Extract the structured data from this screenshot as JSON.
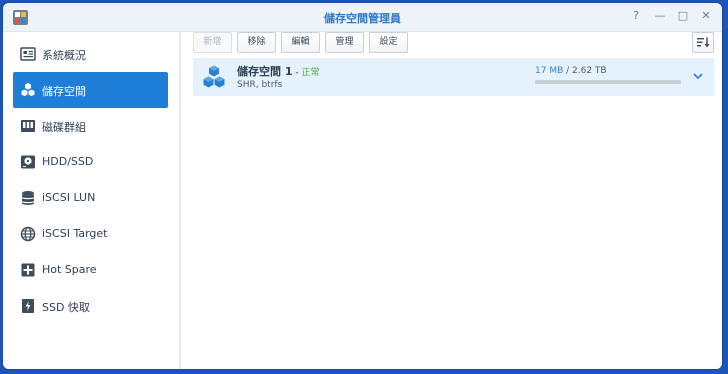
{
  "window": {
    "title": "儲存空間管理員",
    "controls": [
      "help-icon",
      "minimize-icon",
      "maximize-icon",
      "close-icon"
    ],
    "help_glyph": "?",
    "minimize_glyph": "—",
    "maximize_glyph": "□",
    "close_glyph": "✕"
  },
  "sidebar": {
    "items": [
      {
        "label": "系統概況",
        "icon": "overview-icon",
        "active": false
      },
      {
        "label": "儲存空間",
        "icon": "storage-pool-icon",
        "active": true
      },
      {
        "label": "磁碟群組",
        "icon": "disk-group-icon",
        "active": false
      },
      {
        "label": "HDD/SSD",
        "icon": "hdd-icon",
        "active": false
      },
      {
        "label": "iSCSI LUN",
        "icon": "database-icon",
        "active": false
      },
      {
        "label": "iSCSI Target",
        "icon": "globe-icon",
        "active": false
      },
      {
        "label": "Hot Spare",
        "icon": "hot-spare-icon",
        "active": false
      },
      {
        "label": "SSD 快取",
        "icon": "ssd-cache-icon",
        "active": false
      }
    ]
  },
  "toolbar": {
    "create_label": "新增",
    "remove_label": "移除",
    "edit_label": "編輯",
    "manage_label": "管理",
    "settings_label": "設定"
  },
  "pool": {
    "name": "儲存空間 1",
    "separator": " - ",
    "status": "正常",
    "subtitle": "SHR, btrfs",
    "used": "17 MB",
    "usage_separator": " / ",
    "total": "2.62 TB",
    "usage_fraction": 0.0
  },
  "colors": {
    "accent": "#1e7ed8",
    "status_ok": "#4aaa3c",
    "title": "#2f78c8",
    "row_highlight": "#e6f2fb"
  }
}
